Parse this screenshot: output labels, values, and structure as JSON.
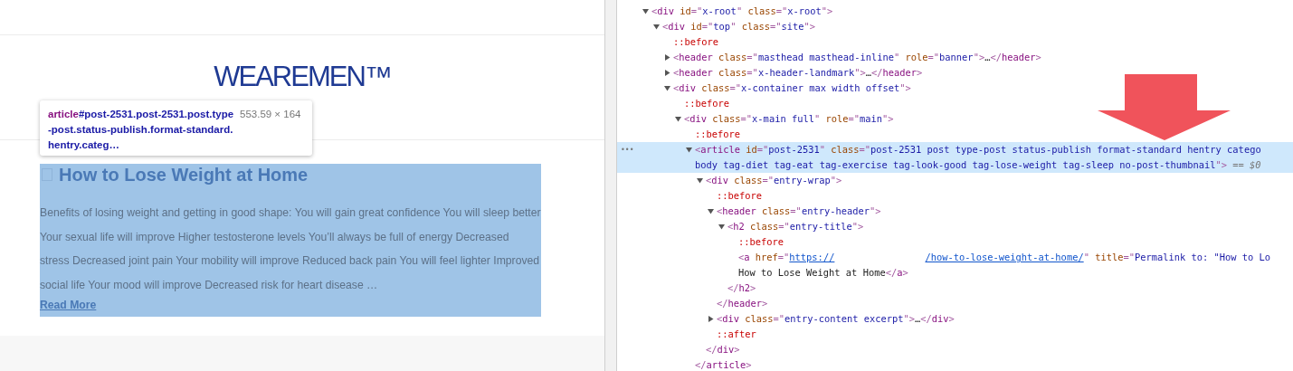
{
  "page": {
    "logo": "WEAREMEN™",
    "article": {
      "selected": true,
      "title": "How to Lose Weight at Home",
      "excerpt": "Benefits of losing weight and getting in good shape: You will gain great confidence You will sleep better Your sexual life will improve Higher testosterone levels You’ll always be full of energy Decreased stress Decreased joint pain Your mobility will improve Reduced back pain You will feel lighter Improved social life Your mood will improve Decreased risk for heart disease …",
      "read_more": "Read More"
    }
  },
  "inspect_tooltip": {
    "tag": "article",
    "selector": "#post-2531.post-2531.post.type-post.status-publish.format-standard.hentry.categ…",
    "size": "553.59 × 164"
  },
  "elements_tree": [
    {
      "expanded": true,
      "selected": false,
      "code": "<div id=\"x-root\" class=\"x-root\">",
      "children": [
        {
          "expanded": true,
          "selected": false,
          "code": "<div id=\"top\" class=\"site\">",
          "children": [
            {
              "selected": false,
              "code": "::before"
            },
            {
              "expanded": false,
              "selected": false,
              "code": "<header class=\"masthead masthead-inline\" role=\"banner\">…</header>"
            },
            {
              "expanded": false,
              "selected": false,
              "code": "<header class=\"x-header-landmark\">…</header>"
            },
            {
              "expanded": true,
              "selected": false,
              "code": "<div class=\"x-container max width offset\">",
              "children": [
                {
                  "selected": false,
                  "code": "::before"
                },
                {
                  "expanded": true,
                  "selected": false,
                  "code": "<div class=\"x-main full\" role=\"main\">",
                  "children": [
                    {
                      "selected": false,
                      "code": "::before"
                    },
                    {
                      "expanded": true,
                      "selected": true,
                      "gutter": "•••",
                      "code": "<article id=\"post-2531\" class=\"post-2531 post type-post status-publish format-standard hentry catego",
                      "code_continued": "body tag-diet tag-eat tag-exercise tag-look-good tag-lose-weight tag-sleep no-post-thumbnail\">",
                      "note": "== $0",
                      "closing": "</article>",
                      "children": [
                        {
                          "expanded": true,
                          "selected": false,
                          "code": "<div class=\"entry-wrap\">",
                          "closing": "</div>",
                          "children": [
                            {
                              "selected": false,
                              "code": "::before"
                            },
                            {
                              "expanded": true,
                              "selected": false,
                              "code": "<header class=\"entry-header\">",
                              "closing": "</header>",
                              "children": [
                                {
                                  "expanded": true,
                                  "selected": false,
                                  "code": "<h2 class=\"entry-title\">",
                                  "closing": "</h2>",
                                  "children": [
                                    {
                                      "selected": false,
                                      "code": "::before"
                                    },
                                    {
                                      "selected": false,
                                      "code": "<a href=\"https://                /how-to-lose-weight-at-home/\" title=\"Permalink to: \"How to Lo"
                                    },
                                    {
                                      "selected": false,
                                      "code": "How to Lose Weight at Home</a>"
                                    }
                                  ]
                                }
                              ]
                            },
                            {
                              "expanded": false,
                              "selected": false,
                              "code": "<div class=\"entry-content excerpt\">…</div>"
                            },
                            {
                              "selected": false,
                              "code": "::after"
                            }
                          ]
                        }
                      ]
                    }
                  ]
                }
              ]
            }
          ]
        }
      ]
    }
  ]
}
